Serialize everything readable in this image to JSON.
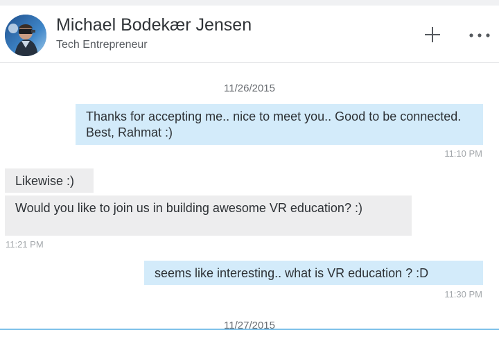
{
  "conversation": {
    "contact_name": "Michael Bodekær Jensen",
    "contact_headline": "Tech Entrepreneur",
    "actions": {
      "add_icon": "plus-icon",
      "more_icon": "more-horizontal-icon"
    }
  },
  "messages": {
    "date_1": "11/26/2015",
    "date_2": "11/27/2015",
    "items": [
      {
        "direction": "sent",
        "text": "Thanks for accepting me.. nice to meet you.. Good to be connected. Best, Rahmat :)",
        "time": "11:10 PM"
      },
      {
        "direction": "received",
        "text": "Likewise :)",
        "time": ""
      },
      {
        "direction": "received",
        "text": "Would you like to join us in building awesome VR education? :)",
        "time": "11:21 PM"
      },
      {
        "direction": "sent",
        "text": "seems like interesting.. what is VR education ? :D",
        "time": "11:30 PM"
      }
    ]
  },
  "colors": {
    "sent_bubble": "#d3ebfa",
    "received_bubble": "#ededee",
    "compose_border": "#7fc2ea"
  }
}
